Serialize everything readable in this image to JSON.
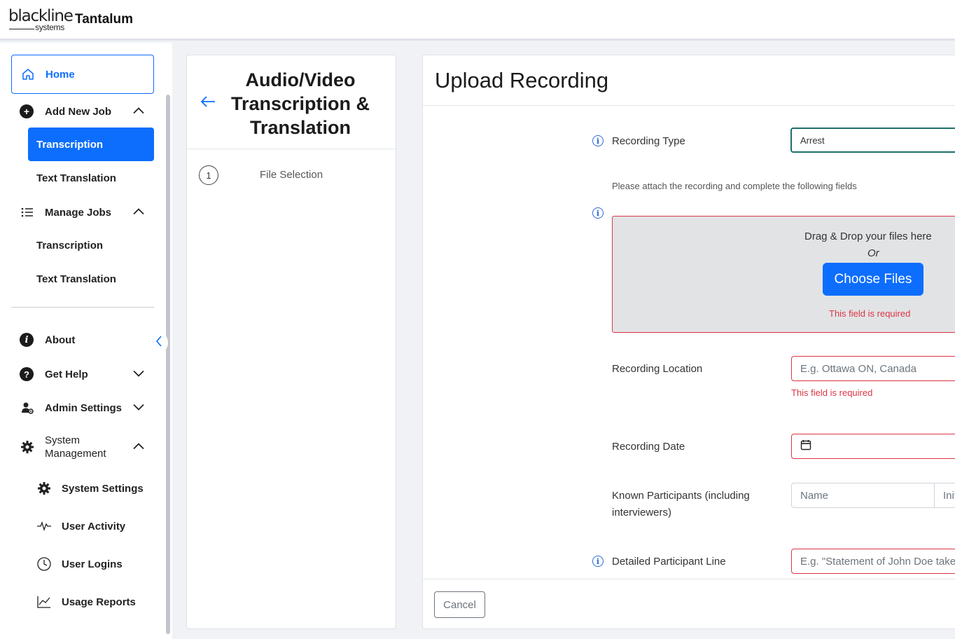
{
  "brand": {
    "logo_top": "blackline",
    "logo_bottom": "systems",
    "product": "Tantalum"
  },
  "sidebar": {
    "home": "Home",
    "add_new_job": "Add New Job",
    "add_sub": [
      "Transcription",
      "Text Translation"
    ],
    "manage_jobs": "Manage Jobs",
    "manage_sub": [
      "Transcription",
      "Text Translation"
    ],
    "about": "About",
    "get_help": "Get Help",
    "admin_settings": "Admin Settings",
    "system_management": "System Management",
    "system_sub": [
      "System Settings",
      "User Activity",
      "User Logins",
      "Usage Reports"
    ]
  },
  "steps": {
    "title": "Audio/Video Transcription & Translation",
    "step_number": "1",
    "step_label": "File Selection"
  },
  "main": {
    "title": "Upload Recording",
    "recording_type_label": "Recording Type",
    "recording_type_value": "Arrest",
    "attach_hint": "Please attach the recording and complete the following fields",
    "drop_text": "Drag & Drop your files here",
    "drop_or": "Or",
    "choose_files": "Choose Files",
    "required": "This field is required",
    "location_label": "Recording Location",
    "location_placeholder": "E.g. Ottawa ON, Canada",
    "date_label": "Recording Date",
    "participants_label": "Known Participants (including interviewers)",
    "participants_name_placeholder": "Name",
    "participants_initials_placeholder": "Initials",
    "detailed_label": "Detailed Participant Line",
    "detailed_placeholder": "E.g. \"Statement of John Doe taken by ...\"",
    "cancel": "Cancel"
  },
  "colors": {
    "primary": "#0d6efd",
    "error": "#dc3545",
    "select_border": "#1d6f6a"
  },
  "icons": [
    "home-icon",
    "plus-circle-icon",
    "list-icon",
    "info-icon",
    "question-icon",
    "user-gear-icon",
    "gear-icon",
    "activity-icon",
    "clock-icon",
    "chart-line-icon",
    "arrow-left-icon",
    "chevron-up-icon",
    "chevron-down-icon",
    "chevron-left-icon",
    "calendar-icon"
  ]
}
